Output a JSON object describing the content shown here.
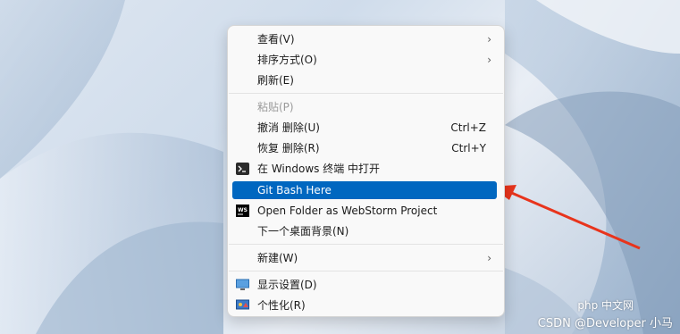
{
  "menu": {
    "items": [
      {
        "label": "查看(V)",
        "submenu": true
      },
      {
        "label": "排序方式(O)",
        "submenu": true
      },
      {
        "label": "刷新(E)"
      },
      {
        "label": "粘贴(P)",
        "disabled": true
      },
      {
        "label": "撤消 删除(U)",
        "shortcut": "Ctrl+Z"
      },
      {
        "label": "恢复 删除(R)",
        "shortcut": "Ctrl+Y"
      },
      {
        "label": "在 Windows 终端 中打开",
        "icon": "terminal-icon"
      },
      {
        "label": "Git Bash Here",
        "highlighted": true
      },
      {
        "label": "Open Folder as WebStorm Project",
        "icon": "webstorm-icon"
      },
      {
        "label": "下一个桌面背景(N)"
      },
      {
        "label": "新建(W)",
        "submenu": true
      },
      {
        "label": "显示设置(D)",
        "icon": "display-icon"
      },
      {
        "label": "个性化(R)",
        "icon": "personalize-icon"
      }
    ]
  },
  "watermark": "CSDN @Developer 小马",
  "php_badge": "php 中文网",
  "colors": {
    "highlight": "#0067c0",
    "arrow": "#e8341c"
  }
}
